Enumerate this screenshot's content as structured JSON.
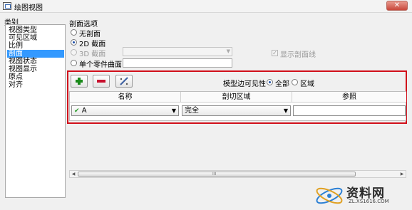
{
  "window": {
    "title": "绘图视图",
    "close_glyph": "✕"
  },
  "category": {
    "label": "类别",
    "items": [
      "视图类型",
      "可见区域",
      "比例",
      "剖面",
      "视图状态",
      "视图显示",
      "原点",
      "对齐"
    ],
    "selected_index": 3
  },
  "section_options": {
    "label": "剖面选项",
    "options": [
      "无剖面",
      "2D 截面",
      "3D 截面",
      "单个零件曲面"
    ],
    "selected": "2D 截面",
    "show_section_lines_label": "显示剖面线",
    "show_section_lines_checked": true
  },
  "toolbar": {
    "add_icon": "plus-icon",
    "remove_icon": "minus-icon",
    "edit_icon": "pencil-icon"
  },
  "model_edge_visibility": {
    "label": "模型边可见性",
    "options": [
      "全部",
      "区域"
    ],
    "selected": "全部"
  },
  "table": {
    "headers": [
      "名称",
      "剖切区域",
      "参照"
    ],
    "rows": [
      {
        "name": "A",
        "name_check": "✔",
        "region": "完全",
        "reference": ""
      }
    ]
  },
  "scrollbar": {
    "grip": "III"
  },
  "watermark": {
    "text": "资料网",
    "url": "ZL.XS1616.COM"
  },
  "colors": {
    "highlight": "#d10f1a",
    "selection": "#3399ff",
    "plus": "#1a8a1a",
    "minus": "#c8102e"
  }
}
